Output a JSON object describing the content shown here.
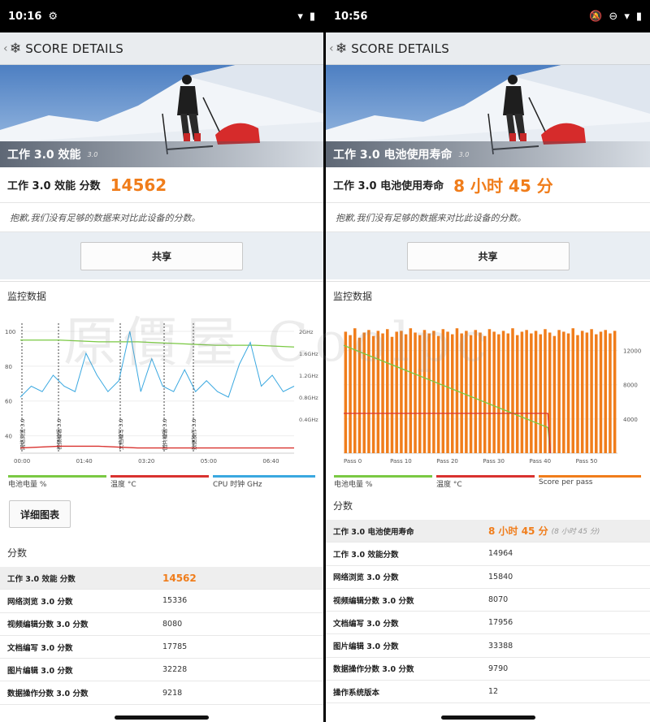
{
  "left": {
    "status": {
      "time": "10:16"
    },
    "appbar": {
      "title": "SCORE DETAILS"
    },
    "hero": {
      "bench": "工作 3.0 效能",
      "ver": "3.0"
    },
    "score": {
      "label": "工作 3.0 效能 分数",
      "value": "14562"
    },
    "note": "抱歉,我们没有足够的数据来对比此设备的分数。",
    "share": "共享",
    "monitor_title": "监控数据",
    "legend": [
      "电池电量 %",
      "温度 °C",
      "CPU 时钟 GHz"
    ],
    "detail_button": "详细图表",
    "scores_title": "分数",
    "rows": [
      {
        "k": "工作 3.0 效能 分数",
        "v": "14562"
      },
      {
        "k": "网络浏览 3.0 分数",
        "v": "15336"
      },
      {
        "k": "视频编辑分数 3.0 分数",
        "v": "8080"
      },
      {
        "k": "文档编写 3.0 分数",
        "v": "17785"
      },
      {
        "k": "图片编辑 3.0 分数",
        "v": "32228"
      },
      {
        "k": "数据操作分数 3.0 分数",
        "v": "9218"
      }
    ]
  },
  "right": {
    "status": {
      "time": "10:56"
    },
    "appbar": {
      "title": "SCORE DETAILS"
    },
    "hero": {
      "bench": "工作 3.0 电池使用寿命",
      "ver": "3.0"
    },
    "score": {
      "label": "工作 3.0 电池使用寿命",
      "value": "8 小时 45 分"
    },
    "note": "抱歉,我们没有足够的数据来对比此设备的分数。",
    "share": "共享",
    "monitor_title": "监控数据",
    "legend": [
      "电池电量 %",
      "温度 °C",
      "Score per pass"
    ],
    "scores_title": "分数",
    "rows": [
      {
        "k": "工作 3.0 电池使用寿命",
        "v": "8 小时 45 分",
        "sub": "(8 小时 45 分)"
      },
      {
        "k": "工作 3.0 效能分数",
        "v": "14964"
      },
      {
        "k": "网络浏览 3.0 分数",
        "v": "15840"
      },
      {
        "k": "视频编辑分数 3.0 分数",
        "v": "8070"
      },
      {
        "k": "文档编写 3.0 分数",
        "v": "17956"
      },
      {
        "k": "图片编辑 3.0 分数",
        "v": "33388"
      },
      {
        "k": "数据操作分数 3.0 分数",
        "v": "9790"
      },
      {
        "k": "操作系统版本",
        "v": "12"
      }
    ]
  },
  "watermark": "原價屋 Coolpc",
  "colors": {
    "accent": "#f07d1b",
    "battery": "#7ac943",
    "temp": "#d9322f",
    "cpu": "#3aa8e0",
    "score": "#f07d1b"
  },
  "chart_data": [
    {
      "type": "line",
      "title": "",
      "x_ticks": [
        "00:00",
        "01:40",
        "03:20",
        "05:00",
        "06:40"
      ],
      "y_left_ticks": [
        40,
        60,
        80,
        100
      ],
      "y_right_ticks": [
        "0.4GHz",
        "0.8GHz",
        "1.2GHz",
        "1.6GHz",
        "2GHz"
      ],
      "markers": [
        "网络浏览 3.0",
        "视频编辑 3.0",
        "文档编写 3.0",
        "图片编辑 3.0",
        "数据操作 3.0"
      ],
      "series": [
        {
          "name": "电池电量 %",
          "values": [
            95,
            95,
            94,
            94,
            93,
            92,
            92,
            91
          ]
        },
        {
          "name": "温度 °C",
          "values": [
            33,
            34,
            34,
            33,
            33,
            33,
            33,
            33
          ]
        },
        {
          "name": "CPU 时钟 GHz",
          "values": [
            0.8,
            1.0,
            0.9,
            1.2,
            1.0,
            0.9,
            1.6,
            1.2,
            0.9,
            1.1,
            2.0,
            0.9,
            1.5,
            1.0,
            0.9,
            1.3,
            0.9,
            1.1,
            0.9,
            0.8,
            1.4,
            1.8,
            1.0,
            1.2,
            0.9,
            1.0
          ]
        }
      ]
    },
    {
      "type": "bar",
      "title": "",
      "x_ticks": [
        "Pass 0",
        "Pass 10",
        "Pass 20",
        "Pass 30",
        "Pass 40",
        "Pass 50"
      ],
      "y_right_ticks": [
        4000,
        8000,
        12000
      ],
      "passes": 59,
      "series": [
        {
          "name": "Score per pass",
          "values": [
            14200,
            13800,
            14600,
            13500,
            14100,
            14400,
            13700,
            14300,
            14000,
            14500,
            13600,
            14200,
            14300,
            13900,
            14600,
            14100,
            13800,
            14400,
            14000,
            14300,
            13700,
            14500,
            14200,
            13900,
            14600,
            14000,
            14300,
            13800,
            14400,
            14100,
            13700,
            14500,
            14200,
            13900,
            14300,
            14000,
            14600,
            13800,
            14200,
            14400,
            14000,
            14300,
            13900,
            14500,
            14100,
            13700,
            14400,
            14200,
            14000,
            14600,
            13800,
            14300,
            14100,
            14500,
            13900,
            14200,
            14400,
            14000,
            14300
          ]
        },
        {
          "name": "电池电量 %",
          "values": [
            84,
            20
          ]
        },
        {
          "name": "温度 °C",
          "values": [
            31,
            31
          ]
        }
      ]
    }
  ]
}
